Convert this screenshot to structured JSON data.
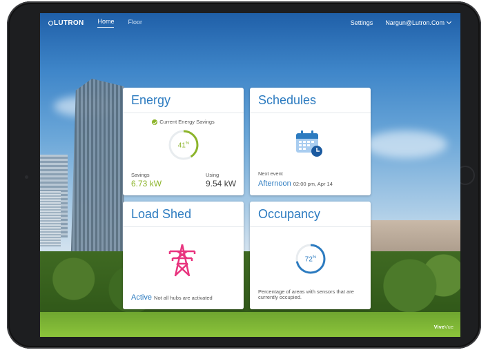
{
  "nav": {
    "logo": "LUTRON",
    "tabs": [
      {
        "label": "Home",
        "active": true
      },
      {
        "label": "Floor",
        "active": false
      }
    ],
    "settings_label": "Settings",
    "user_email": "Nargun@Lutron.Com"
  },
  "energy": {
    "title": "Energy",
    "subtitle": "Current Energy Savings",
    "savings_percent": 41,
    "savings_percent_label": "41",
    "percent_sign": "%",
    "savings_label": "Savings",
    "savings_value": "6.73 kW",
    "using_label": "Using",
    "using_value": "9.54 kW"
  },
  "schedules": {
    "title": "Schedules",
    "icon": "calendar-clock-icon",
    "next_event_label": "Next event",
    "next_event_name": "Afternoon",
    "next_event_time": "02:00 pm, Apr 14"
  },
  "load_shed": {
    "title": "Load Shed",
    "icon": "power-tower-icon",
    "status": "Active",
    "note": "Not all hubs are activated"
  },
  "occupancy": {
    "title": "Occupancy",
    "percent": 72,
    "percent_label": "72",
    "percent_sign": "%",
    "description": "Percentage of areas with sensors that are currently occupied."
  },
  "brand": {
    "part1": "Vive",
    "part2": "Vue"
  },
  "colors": {
    "accent_blue": "#2c7bc0",
    "savings_green": "#8cb42a",
    "load_pink": "#e8337e"
  }
}
